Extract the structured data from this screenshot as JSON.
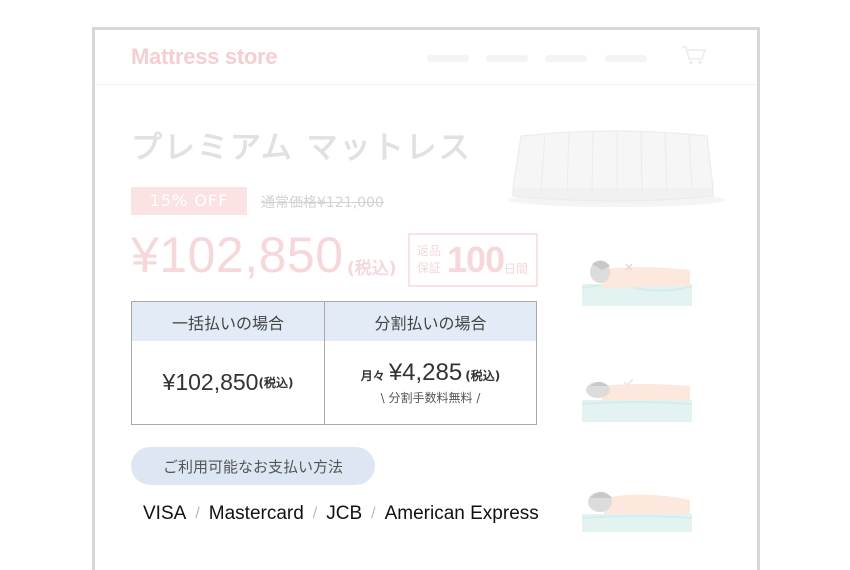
{
  "header": {
    "brand": "Mattress store",
    "nav_count": 4
  },
  "product": {
    "title": "プレミアム マットレス",
    "discount_badge": "15% OFF",
    "regular_price": "通常価格¥121,000",
    "price": "¥102,850",
    "price_tax": "(税込)",
    "return_label": "返品保証",
    "return_days": "100",
    "return_unit": "日間"
  },
  "payment_table": {
    "lump_header": "一括払いの場合",
    "installment_header": "分割払いの場合",
    "lump_price": "¥102,850",
    "lump_tax": "(税込)",
    "installment_prefix": "月々",
    "installment_price": "¥4,285",
    "installment_tax": "(税込)",
    "installment_note": "\\ 分割手数料無料 /"
  },
  "payment_methods": {
    "button_label": "ご利用可能なお支払い方法",
    "cards": [
      "VISA",
      "Mastercard",
      "JCB",
      "American Express"
    ],
    "separator": "/"
  },
  "colors": {
    "brand_pink": "#f3cfd2",
    "table_header": "#e3ecf6",
    "button_blue": "#dde7f3"
  }
}
